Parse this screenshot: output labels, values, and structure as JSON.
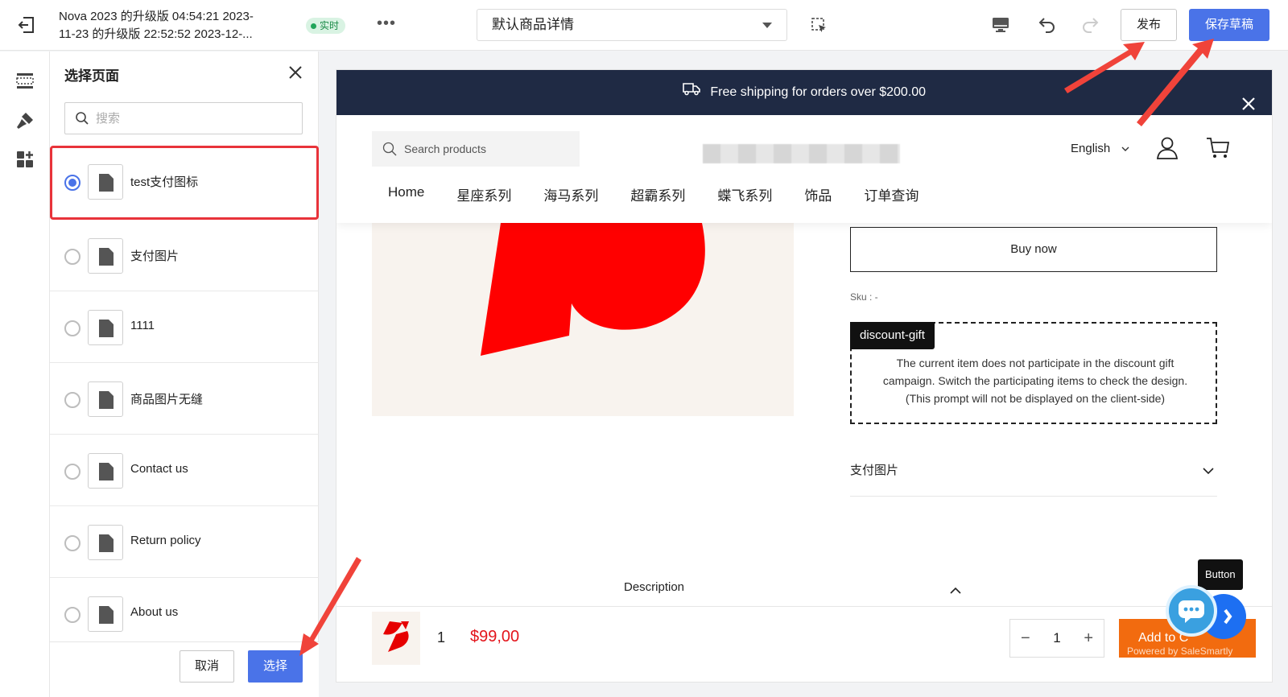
{
  "topbar": {
    "title_line1": "Nova 2023 的升级版 04:54:21 2023-",
    "title_line2": "11-23 的升级版 22:52:52 2023-12-...",
    "live_badge": "实时",
    "page_select_value": "默认商品详情",
    "publish_label": "发布",
    "save_draft_label": "保存草稿",
    "accent_color": "#4a73e8"
  },
  "panel": {
    "title": "选择页面",
    "search_placeholder": "搜索",
    "pages": [
      {
        "label": "test支付图标",
        "selected": true
      },
      {
        "label": "支付图片",
        "selected": false
      },
      {
        "label": "1111",
        "selected": false
      },
      {
        "label": "商品图片无缝",
        "selected": false
      },
      {
        "label": "Contact us",
        "selected": false
      },
      {
        "label": "Return policy",
        "selected": false
      },
      {
        "label": "About us",
        "selected": false
      }
    ],
    "cancel_label": "取消",
    "choose_label": "选择"
  },
  "preview": {
    "announcement": "Free shipping for orders over $200.00",
    "search_placeholder": "Search products",
    "language": "English",
    "nav": [
      "Home",
      "星座系列",
      "海马系列",
      "超霸系列",
      "蝶飞系列",
      "饰品",
      "订单查询"
    ],
    "buy_now": "Buy now",
    "sku": "Sku : -",
    "gift_tag": "discount-gift",
    "gift_line1": "The current item does not participate in the discount gift",
    "gift_line2": "campaign. Switch the participating items to check the design.",
    "gift_line3": "(This prompt will not be displayed on the client-side)",
    "accordion_title": "支付图片",
    "description_tab": "Description",
    "sticky_qty": "1",
    "sticky_price": "$99,00",
    "stepper_value": "1",
    "add_to_cart": "Add to C",
    "powered": "Powered by SaleSmartly",
    "tooltip": "Button",
    "price_color": "#e3141b",
    "announce_bg": "#1f2a44"
  }
}
